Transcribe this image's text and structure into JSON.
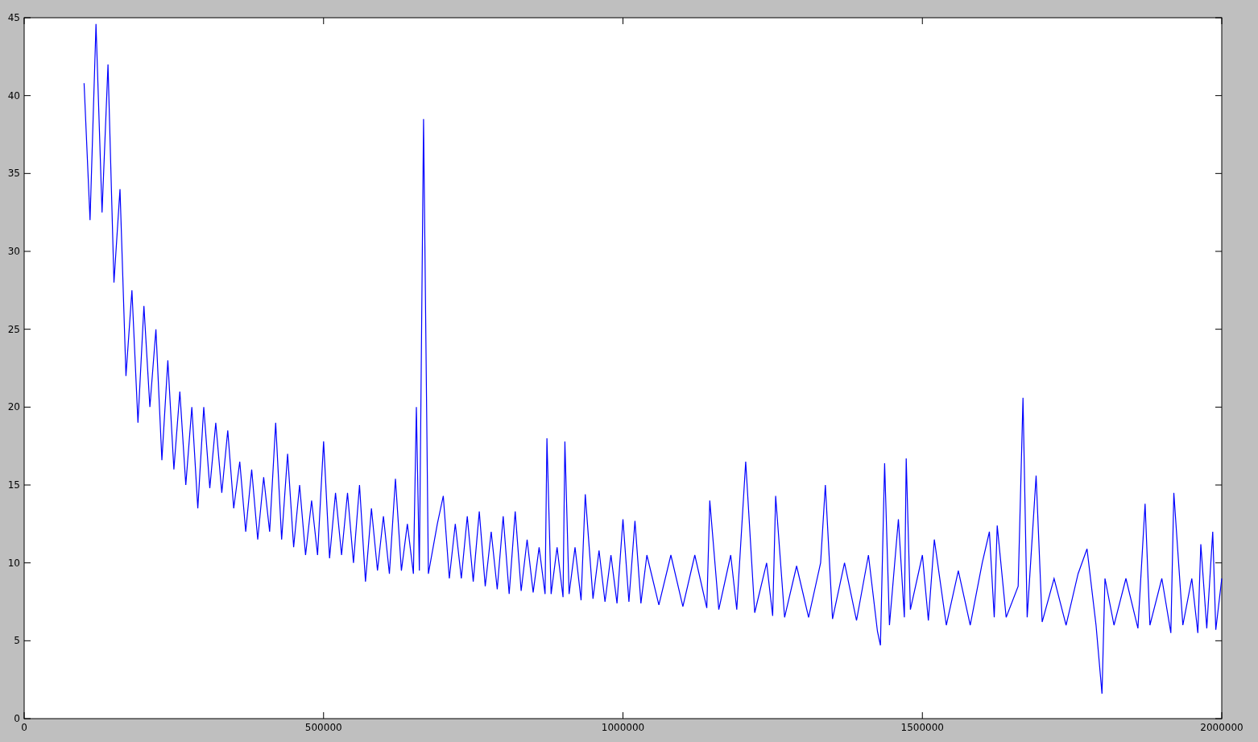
{
  "chart_data": {
    "type": "line",
    "x": [
      100000,
      110000,
      120000,
      130000,
      140000,
      150000,
      160000,
      170000,
      180000,
      190000,
      200000,
      210000,
      220000,
      230000,
      240000,
      250000,
      260000,
      270000,
      280000,
      290000,
      300000,
      310000,
      320000,
      330000,
      340000,
      350000,
      360000,
      370000,
      380000,
      390000,
      400000,
      410000,
      420000,
      430000,
      440000,
      450000,
      460000,
      470000,
      480000,
      490000,
      500000,
      510000,
      520000,
      530000,
      540000,
      550000,
      560000,
      570000,
      580000,
      590000,
      600000,
      610000,
      620000,
      630000,
      640000,
      650000,
      655000,
      660000,
      667000,
      675000,
      690000,
      700000,
      710000,
      720000,
      730000,
      740000,
      750000,
      760000,
      770000,
      780000,
      790000,
      800000,
      810000,
      820000,
      830000,
      840000,
      850000,
      860000,
      870000,
      873000,
      880000,
      890000,
      900000,
      903000,
      910000,
      920000,
      930000,
      937000,
      950000,
      960000,
      970000,
      980000,
      990000,
      1000000,
      1010000,
      1020000,
      1030000,
      1040000,
      1060000,
      1080000,
      1100000,
      1120000,
      1140000,
      1145000,
      1160000,
      1180000,
      1190000,
      1205000,
      1220000,
      1240000,
      1250000,
      1255000,
      1270000,
      1290000,
      1310000,
      1330000,
      1338000,
      1350000,
      1370000,
      1390000,
      1410000,
      1425000,
      1430000,
      1437000,
      1445000,
      1460000,
      1470000,
      1473000,
      1480000,
      1500000,
      1510000,
      1520000,
      1540000,
      1560000,
      1580000,
      1600000,
      1612000,
      1620000,
      1625000,
      1640000,
      1660000,
      1668000,
      1675000,
      1690000,
      1700000,
      1720000,
      1740000,
      1760000,
      1775000,
      1790000,
      1800000,
      1805000,
      1820000,
      1840000,
      1860000,
      1872000,
      1880000,
      1900000,
      1915000,
      1920000,
      1935000,
      1950000,
      1960000,
      1965000,
      1975000,
      1985000,
      1990000,
      2000000
    ],
    "series": [
      {
        "color": "#0000ff",
        "values": [
          40.8,
          32,
          44.6,
          32.5,
          42,
          28,
          34,
          22,
          27.5,
          19,
          26.5,
          20,
          25,
          16.6,
          23,
          16,
          21,
          15,
          20,
          13.5,
          20,
          14.8,
          19,
          14.5,
          18.5,
          13.5,
          16.5,
          12,
          16,
          11.5,
          15.5,
          12,
          19,
          11.5,
          17,
          11,
          15,
          10.5,
          14,
          10.5,
          17.8,
          10.3,
          14.5,
          10.5,
          14.5,
          10,
          15,
          8.8,
          13.5,
          9.5,
          13,
          9.3,
          15.4,
          9.5,
          12.5,
          9.3,
          20,
          9.5,
          38.5,
          9.3,
          12.5,
          14.3,
          9,
          12.5,
          9,
          13,
          8.8,
          13.3,
          8.5,
          12,
          8.3,
          13,
          8,
          13.3,
          8.2,
          11.5,
          8.1,
          11,
          8,
          18,
          8,
          11,
          7.8,
          17.8,
          8,
          11,
          7.6,
          14.4,
          7.7,
          10.8,
          7.5,
          10.5,
          7.4,
          12.8,
          7.5,
          12.7,
          7.4,
          10.5,
          7.3,
          10.5,
          7.2,
          10.5,
          7.1,
          14,
          7,
          10.5,
          7,
          16.5,
          6.8,
          10,
          6.6,
          14.3,
          6.5,
          9.8,
          6.5,
          10,
          15,
          6.4,
          10,
          6.3,
          10.5,
          5.6,
          4.7,
          16.4,
          6,
          12.8,
          6.5,
          16.7,
          7,
          10.5,
          6.3,
          11.5,
          6,
          9.5,
          6,
          10,
          12,
          6.5,
          12.4,
          6.5,
          8.5,
          20.6,
          6.5,
          15.6,
          6.2,
          9,
          6,
          9.3,
          10.9,
          6,
          1.6,
          9,
          6,
          9,
          5.8,
          13.8,
          6,
          9,
          5.5,
          14.5,
          6,
          9,
          5.5,
          11.2,
          5.8,
          12,
          5.7,
          9
        ]
      }
    ],
    "xlim": [
      0,
      2000000
    ],
    "ylim": [
      0,
      45
    ],
    "xticks": [
      0,
      500000,
      1000000,
      1500000,
      2000000
    ],
    "yticks": [
      0,
      5,
      10,
      15,
      20,
      25,
      30,
      35,
      40,
      45
    ]
  }
}
